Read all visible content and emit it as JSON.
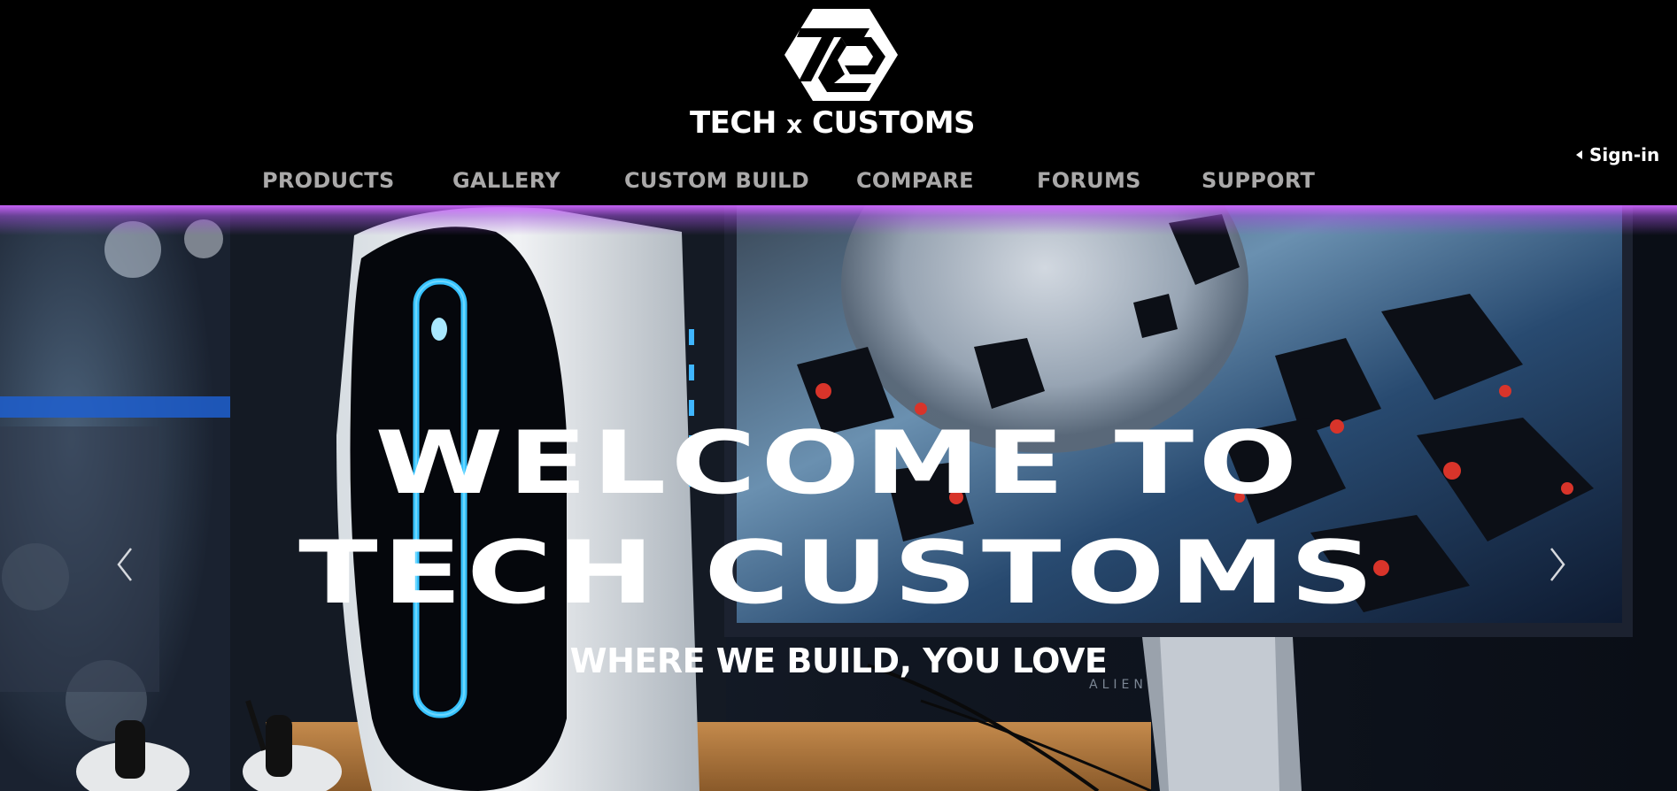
{
  "header": {
    "logo_icon": "tc-hexagon-logo-icon",
    "brand": {
      "left": "TECH",
      "middle": "x",
      "right": "CUSTOMS"
    },
    "nav": [
      {
        "label": "PRODUCTS"
      },
      {
        "label": "GALLERY"
      },
      {
        "label": "CUSTOM BUILD"
      },
      {
        "label": "COMPARE"
      },
      {
        "label": "FORUMS"
      },
      {
        "label": "SUPPORT"
      }
    ],
    "signin": {
      "label": "Sign-in",
      "icon": "caret-left-icon"
    }
  },
  "hero": {
    "title_line1": "WELCOME TO",
    "title_line2": "TECH CUSTOMS",
    "subtitle": "WHERE WE BUILD, YOU LOVE",
    "monitor_brand": "ALIENWARE",
    "prev_icon": "chevron-left-icon",
    "next_icon": "chevron-right-icon",
    "accent_color": "#c864ff"
  }
}
